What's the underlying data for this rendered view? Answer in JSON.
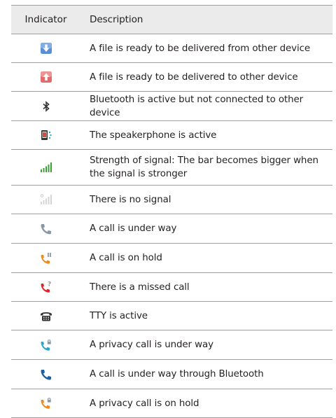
{
  "header": {
    "indicator": "Indicator",
    "description": "Description"
  },
  "rows": [
    {
      "icon": "download-arrow-icon",
      "description": "A file is ready to be delivered from other device"
    },
    {
      "icon": "upload-arrow-icon",
      "description": "A file is ready to be delivered to other device"
    },
    {
      "icon": "bluetooth-icon",
      "description": "Bluetooth is active but not connected to other device"
    },
    {
      "icon": "speakerphone-icon",
      "description": "The speakerphone is active"
    },
    {
      "icon": "signal-strength-icon",
      "description": "Strength of signal: The bar becomes bigger when the signal is stronger"
    },
    {
      "icon": "no-signal-icon",
      "description": "There is no signal"
    },
    {
      "icon": "call-active-icon",
      "description": "A call is under way"
    },
    {
      "icon": "call-hold-icon",
      "description": "A call is on hold"
    },
    {
      "icon": "missed-call-icon",
      "description": "There is a missed call"
    },
    {
      "icon": "tty-icon",
      "description": "TTY is active"
    },
    {
      "icon": "privacy-call-icon",
      "description": "A privacy call is under way"
    },
    {
      "icon": "bluetooth-call-icon",
      "description": "A call is under way through Bluetooth"
    },
    {
      "icon": "privacy-call-hold-icon",
      "description": "A privacy call is on hold"
    }
  ],
  "colors": {
    "header_bg": "#ebebeb",
    "rule": "#9d9d9d",
    "download_blue": "#5a8fd6",
    "upload_red": "#e46b6b",
    "signal_green": "#3aa136",
    "phone_gray": "#8a9aa5",
    "phone_orange": "#f08a1c",
    "phone_red": "#d9262a",
    "phone_teal": "#2aa7c9",
    "phone_blue": "#1f5fa8"
  }
}
